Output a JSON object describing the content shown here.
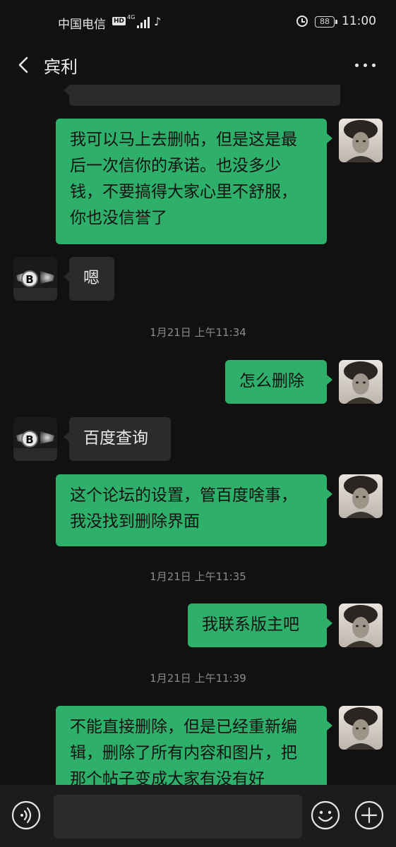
{
  "status_bar": {
    "carrier": "中国电信",
    "hd": "HD",
    "network": "4G",
    "battery": "88",
    "time": "11:00",
    "icons": [
      "signal-icon",
      "tiktok-icon",
      "alarm-icon",
      "battery-icon"
    ]
  },
  "header": {
    "title": "宾利",
    "back_icon": "chevron-left-icon",
    "more_icon": "more-dots-icon"
  },
  "messages": [
    {
      "sender": "me",
      "text": "我可以马上去删帖，但是这是最后一次信你的承诺。也没多少钱，不要搞得大家心里不舒服，你也没信誉了"
    },
    {
      "sender": "them",
      "text": "嗯"
    },
    {
      "type": "time",
      "text": "1月21日 上午11:34"
    },
    {
      "sender": "me",
      "text": "怎么删除"
    },
    {
      "sender": "them",
      "text": "百度查询"
    },
    {
      "sender": "me",
      "text": "这个论坛的设置，管百度啥事，我没找到删除界面"
    },
    {
      "type": "time",
      "text": "1月21日 上午11:35"
    },
    {
      "sender": "me",
      "text": "我联系版主吧"
    },
    {
      "type": "time",
      "text": "1月21日 上午11:39"
    },
    {
      "sender": "me",
      "text": "不能直接删除，但是已经重新编辑，删除了所有内容和图片，把那个帖子变成大家有没有好"
    }
  ],
  "input_bar": {
    "voice_icon": "voice-icon",
    "emoji_icon": "emoji-icon",
    "plus_icon": "plus-icon"
  },
  "colors": {
    "background": "#111111",
    "my_bubble": "#2fb06a",
    "their_bubble": "#2b2b2b",
    "timestamp": "#8a8a8a"
  }
}
